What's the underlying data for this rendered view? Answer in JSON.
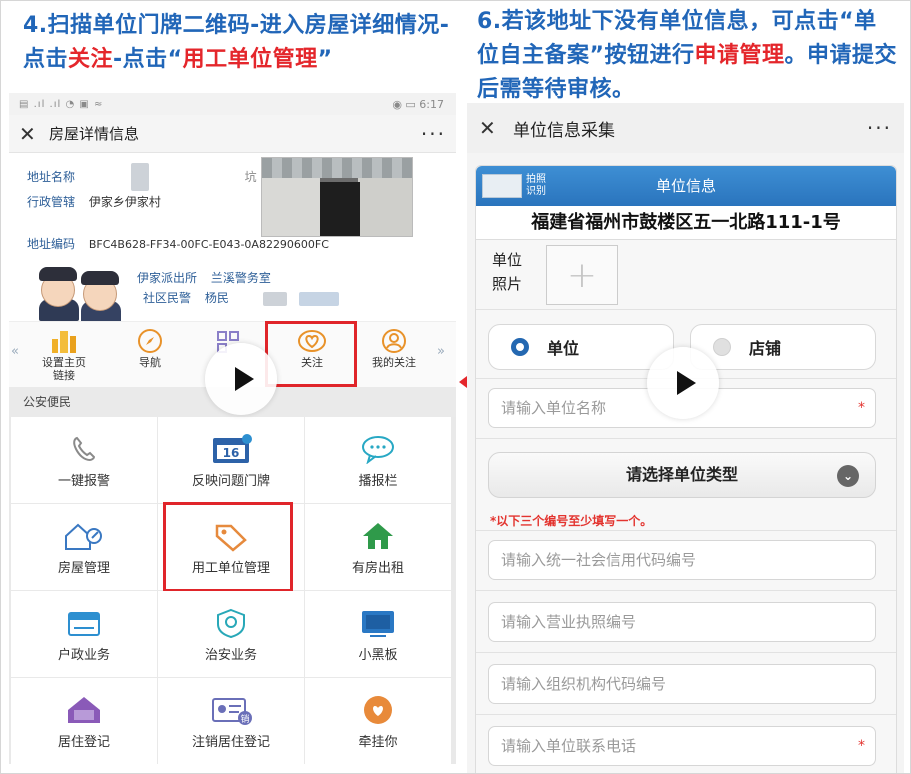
{
  "captions": {
    "left": {
      "p1": "4.扫描单位门牌二维码-进入房屋详细情况-点击",
      "p2": "关注",
      "p3": "-点击“",
      "p4": "用工单位管理",
      "p5": "”"
    },
    "right": {
      "p1": "6.若该地址下没有单位信息，可点击“单位自主备案”按钮进行",
      "p2": "申请管理",
      "p3": "。申请提交后需等待审核。"
    }
  },
  "left_phone": {
    "status": {
      "time": "6:17",
      "battery_icon": "battery-icon",
      "wifi_icon": "wifi-icon"
    },
    "nav": {
      "close": "✕",
      "title": "房屋详情信息",
      "more": "···"
    },
    "info": {
      "address_label": "地址名称",
      "address_tail": "坑",
      "district_label": "行政管辖",
      "district_value": "伊家乡伊家村",
      "code_label": "地址编码",
      "code_value": "BFC4B628-FF34-00FC-E043-0A82290600FC",
      "station": "伊家派出所",
      "police_office": "兰溪警务室",
      "community_police_label": "社区民警",
      "community_police_value": "杨民"
    },
    "quick_items": [
      {
        "icon": "building-icon",
        "label": "设置主页\n链接"
      },
      {
        "icon": "compass-icon",
        "label": "导航"
      },
      {
        "icon": "qr-icon",
        "label": ""
      },
      {
        "icon": "heart-icon",
        "label": "关注"
      },
      {
        "icon": "user-follow-icon",
        "label": "我的关注"
      }
    ],
    "section_title": "公安便民",
    "grid": [
      {
        "icon": "phone-icon",
        "label": "一键报警",
        "color": "#8a8a8a"
      },
      {
        "icon": "calendar-icon",
        "label": "反映问题门牌",
        "color": "#2d62a8",
        "badge": "16"
      },
      {
        "icon": "chat-icon",
        "label": "播报栏",
        "color": "#28a8c4"
      },
      {
        "icon": "house-key-icon",
        "label": "房屋管理",
        "color": "#3a78c2"
      },
      {
        "icon": "tag-icon",
        "label": "用工单位管理",
        "color": "#e68a3d"
      },
      {
        "icon": "house-icon",
        "label": "有房出租",
        "color": "#2f9a4a"
      },
      {
        "icon": "id-card-icon",
        "label": "户政业务",
        "color": "#2d8fd0"
      },
      {
        "icon": "shield-icon",
        "label": "治安业务",
        "color": "#28a8b8"
      },
      {
        "icon": "board-icon",
        "label": "小黑板",
        "color": "#2a78c4"
      },
      {
        "icon": "home-user-icon",
        "label": "居住登记",
        "color": "#8a5ab8"
      },
      {
        "icon": "cancel-card-icon",
        "label": "注销居住登记",
        "color": "#6a6fb8",
        "badge": "销"
      },
      {
        "icon": "hands-heart-icon",
        "label": "牵挂你",
        "color": "#e88a3a"
      }
    ]
  },
  "right_phone": {
    "nav": {
      "close": "✕",
      "title": "单位信息采集",
      "more": "···"
    },
    "form": {
      "scan_label": "拍照\n识别",
      "header_title": "单位信息",
      "address": "福建省福州市鼓楼区五一北路111-1号",
      "photo_label": "单位\n照片",
      "radio_options": [
        {
          "label": "单位",
          "selected": true
        },
        {
          "label": "店铺",
          "selected": false
        }
      ],
      "name_placeholder": "请输入单位名称",
      "type_select": "请选择单位类型",
      "note": "*以下三个编号至少填写一个。",
      "credit_code_placeholder": "请输入统一社会信用代码编号",
      "license_placeholder": "请输入营业执照编号",
      "org_code_placeholder": "请输入组织机构代码编号",
      "phone_placeholder": "请输入单位联系电话",
      "required_mark": "*"
    }
  },
  "colors": {
    "caption_blue": "#2166b8",
    "caption_red": "#e4262b",
    "highlight": "#e0252a",
    "form_header": "#2a74bd"
  }
}
